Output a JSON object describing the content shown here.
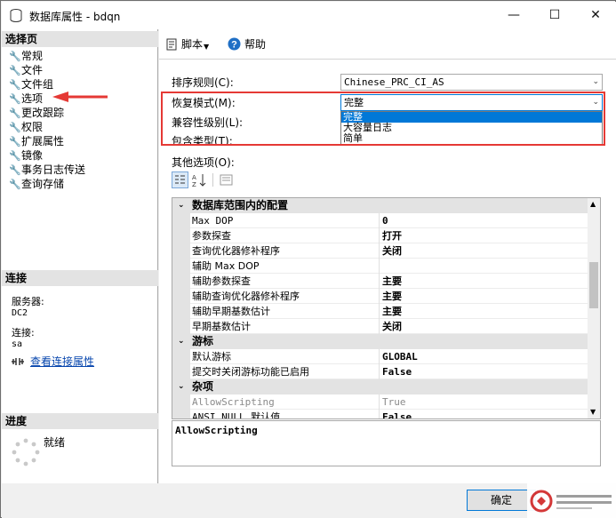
{
  "window": {
    "title": "数据库属性 - bdqn",
    "controls": {
      "minimize": "—",
      "maximize": "☐",
      "close": "✕"
    }
  },
  "left_pane": {
    "select_page_header": "选择页",
    "pages": [
      {
        "label": "常规",
        "icon": "wrench-icon"
      },
      {
        "label": "文件",
        "icon": "wrench-icon"
      },
      {
        "label": "文件组",
        "icon": "wrench-icon"
      },
      {
        "label": "选项",
        "icon": "wrench-icon",
        "selected": true
      },
      {
        "label": "更改跟踪",
        "icon": "wrench-icon"
      },
      {
        "label": "权限",
        "icon": "wrench-icon"
      },
      {
        "label": "扩展属性",
        "icon": "wrench-icon"
      },
      {
        "label": "镜像",
        "icon": "wrench-icon"
      },
      {
        "label": "事务日志传送",
        "icon": "wrench-icon"
      },
      {
        "label": "查询存储",
        "icon": "wrench-icon"
      }
    ],
    "connection_header": "连接",
    "server_label": "服务器:",
    "server_value": "DC2",
    "connection_label": "连接:",
    "connection_value": "sa",
    "view_connection_link": "查看连接属性",
    "progress_header": "进度",
    "progress_status": "就绪"
  },
  "toolbar": {
    "script_label": "脚本",
    "help_label": "帮助"
  },
  "form": {
    "collation_label": "排序规则(C):",
    "collation_value": "Chinese_PRC_CI_AS",
    "recovery_label": "恢复模式(M):",
    "recovery_value": "完整",
    "recovery_options": [
      "完整",
      "大容量日志",
      "简单"
    ],
    "compat_label": "兼容性级别(L):",
    "containment_label": "包含类型(T):",
    "other_options_label": "其他选项(O):"
  },
  "property_grid": {
    "categories": [
      {
        "name": "数据库范围内的配置",
        "rows": [
          {
            "name": "Max DOP",
            "value": "0",
            "mono": true
          },
          {
            "name": "参数探查",
            "value": "打开"
          },
          {
            "name": "查询优化器修补程序",
            "value": "关闭"
          },
          {
            "name": "辅助 Max DOP",
            "value": ""
          },
          {
            "name": "辅助参数探查",
            "value": "主要"
          },
          {
            "name": "辅助查询优化器修补程序",
            "value": "主要"
          },
          {
            "name": "辅助早期基数估计",
            "value": "主要"
          },
          {
            "name": "早期基数估计",
            "value": "关闭"
          }
        ]
      },
      {
        "name": "游标",
        "rows": [
          {
            "name": "默认游标",
            "value": "GLOBAL"
          },
          {
            "name": "提交时关闭游标功能已启用",
            "value": "False"
          }
        ]
      },
      {
        "name": "杂项",
        "rows": [
          {
            "name": "AllowScripting",
            "value": "True",
            "disabled": true
          },
          {
            "name": "ANSI NULL 默认值",
            "value": "False"
          }
        ]
      }
    ],
    "description": "AllowScripting"
  },
  "buttons": {
    "ok": "确定"
  },
  "colors": {
    "highlight_box": "#e53935",
    "arrow": "#e53935",
    "dropdown_selected": "#0078d7",
    "link": "#0645ad"
  }
}
